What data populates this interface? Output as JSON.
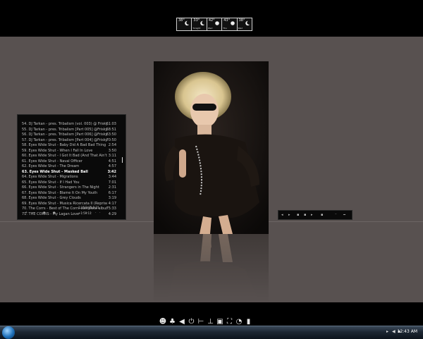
{
  "weather": [
    {
      "temp": "38°",
      "name": "",
      "icon": "moon-icon"
    },
    {
      "temp": "33°",
      "name": "Tonight",
      "icon": "moon-icon"
    },
    {
      "temp": "42°",
      "name": "Wed",
      "icon": "sun-icon"
    },
    {
      "temp": "43°",
      "name": "Thu",
      "icon": "sun-icon"
    },
    {
      "temp": "38°",
      "name": "Wed",
      "icon": "moon-icon"
    }
  ],
  "playlist": {
    "tracks": [
      {
        "title": "54. DJ Tarkan - pres. Tribalism (vol. 003) @ Frisky ...",
        "duration": "61:03"
      },
      {
        "title": "55. DJ Tarkan - pres. Tribalism [Part 005] @Frisky R...",
        "duration": "58:51"
      },
      {
        "title": "56. DJ Tarkan - pres. Tribalism [Part 006] @Frisky R...",
        "duration": "63:50"
      },
      {
        "title": "57. DJ Tarkan - pres. Tribalism [Part 004] @Frisky R...",
        "duration": "70:50"
      },
      {
        "title": "58. Eyes Wide Shut - Baby Did A Bad Bad Thing",
        "duration": "2:54"
      },
      {
        "title": "59. Eyes Wide Shut - When I Fall In Love",
        "duration": "3:50"
      },
      {
        "title": "60. Eyes Wide Shut - I Got It Bad (And That Ain't Goo...",
        "duration": "3:11"
      },
      {
        "title": "61. Eyes Wide Shut - Naval Officer",
        "duration": "4:51"
      },
      {
        "title": "62. Eyes Wide Shut - The Dream",
        "duration": "4:57"
      },
      {
        "title": "63. Eyes Wide Shut - Masked Ball",
        "duration": "3:42"
      },
      {
        "title": "64. Eyes Wide Shut - Migrations",
        "duration": "3:44"
      },
      {
        "title": "65. Eyes Wide Shut - If I Had You",
        "duration": "7:01"
      },
      {
        "title": "66. Eyes Wide Shut - Strangers in The Night",
        "duration": "2:31"
      },
      {
        "title": "67. Eyes Wide Shut - Blame It On My Youth",
        "duration": "6:17"
      },
      {
        "title": "68. Eyes Wide Shut - Grey Clouds",
        "duration": "3:19"
      },
      {
        "title": "69. Eyes Wide Shut - Musica Ricercata II (Reprise)",
        "duration": "4:17"
      },
      {
        "title": "70. The Corrs - Best of The Corrs-complete album",
        "duration": "75:33"
      },
      {
        "title": "71. THE CORRS - My Lagan Love",
        "duration": "4:29"
      }
    ],
    "selected_index": 9,
    "info_line1": "1:15/2:05:1:31",
    "info_line2": "+1:59:11"
  },
  "clock": "12:43 AM",
  "colors": {
    "stage": "#585150",
    "taskbar": "#1c2632",
    "accent": "#1d6fb8"
  }
}
